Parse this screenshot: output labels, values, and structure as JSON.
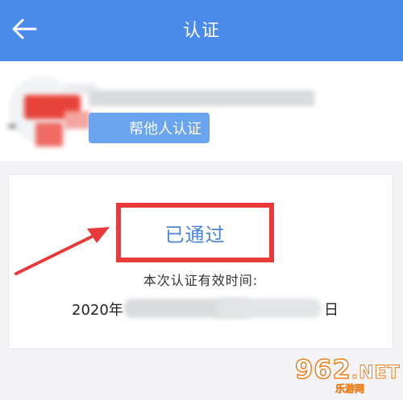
{
  "header": {
    "title": "认证",
    "back_icon": "arrow-left-icon",
    "background": "#4a8ae8"
  },
  "profile": {
    "help_button_label": "帮他人认证"
  },
  "status_card": {
    "status": "已通过",
    "status_color": "#4a86d8",
    "highlight_color": "#e83a3a",
    "valid_time_label": "本次认证有效时间:",
    "valid_date_year": "2020年",
    "valid_date_day": "日"
  },
  "watermark": {
    "brand": "962",
    "brand_suffix": ".NET",
    "subtitle": "乐游网",
    "color": "#f07e1b"
  }
}
